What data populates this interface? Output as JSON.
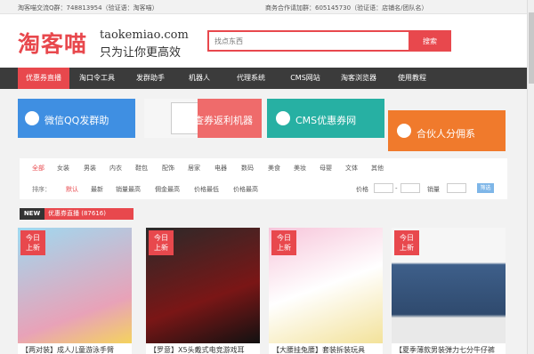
{
  "topbar": {
    "group_label": "淘客喵交流Q群：748813954（验证语：淘客喵）",
    "biz_label": "商务合作请加群：605145730（验证语：店铺名/团队名）"
  },
  "header": {
    "logo": "淘客喵",
    "domain": "taokemiao.com",
    "slogan": "只为让你更高效",
    "search_placeholder": "找点东西",
    "search_button": "搜索"
  },
  "nav": {
    "items": [
      "优惠券直播",
      "淘口令工具",
      "发群助手",
      "机器人",
      "代理系统",
      "CMS网站",
      "淘客浏览器",
      "使用教程"
    ]
  },
  "banners": [
    {
      "label": "微信QQ发群助",
      "color": "#3f8fe2"
    },
    {
      "label": "查券返利机器",
      "color": "#ef6b6b"
    },
    {
      "label": "CMS优惠券网",
      "color": "#27b0a3"
    },
    {
      "label": "合伙人分佣系",
      "color": "#f07a2c"
    }
  ],
  "filters": {
    "categories": [
      "全部",
      "女装",
      "男装",
      "内衣",
      "鞋包",
      "配饰",
      "居家",
      "电器",
      "数码",
      "美食",
      "美妆",
      "母婴",
      "文体",
      "其他"
    ],
    "sort_label": "排序：",
    "sorts": [
      "默认",
      "最新",
      "销量最高",
      "佣金最高",
      "价格最低",
      "价格最高"
    ],
    "price_label": "价格",
    "sales_label": "销量",
    "filter_button": "筛选"
  },
  "section": {
    "new_tag": "NEW",
    "title": "优惠券直播 (87616)"
  },
  "products": [
    {
      "badge_line1": "今日",
      "badge_line2": "上新",
      "title": "【两对装】成人儿童游泳手臂"
    },
    {
      "badge_line1": "今日",
      "badge_line2": "上新",
      "title": "【罗意】X5头戴式电竞游戏耳"
    },
    {
      "badge_line1": "今日",
      "badge_line2": "上新",
      "title": "【大腰挂兔腰】套装拆装玩具"
    },
    {
      "badge_line1": "今日",
      "badge_line2": "上新",
      "title": "【夏季薄款男装弹力七分牛仔裤"
    }
  ],
  "colors": {
    "accent": "#e8484d",
    "nav_bg": "#3b3b3b"
  }
}
